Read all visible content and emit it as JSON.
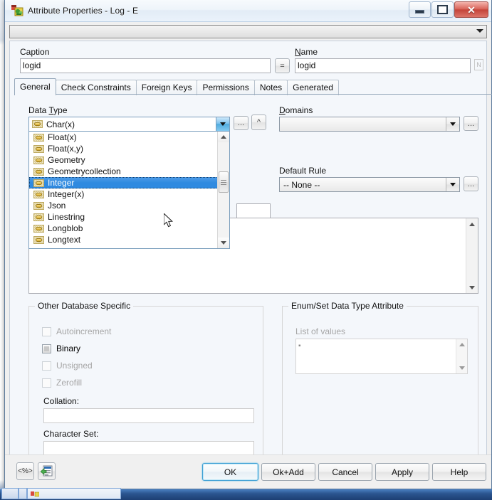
{
  "window": {
    "title": "Attribute Properties - Log - E",
    "icon": "attribute-properties-icon",
    "minimize_label": "Minimize",
    "maximize_label": "Maximize",
    "close_label": "Close"
  },
  "toolbar": {
    "overflow_label": "Toolbar options"
  },
  "fields": {
    "caption_label": "Caption",
    "caption_value": "logid",
    "equals_button": "=",
    "name_label": "Name",
    "name_label_accesskey": "N",
    "name_value": "logid",
    "name_side_button": "N"
  },
  "tabs": [
    {
      "label": "General",
      "active": true
    },
    {
      "label": "Check Constraints",
      "active": false
    },
    {
      "label": "Foreign Keys",
      "active": false
    },
    {
      "label": "Permissions",
      "active": false
    },
    {
      "label": "Notes",
      "active": false
    },
    {
      "label": "Generated",
      "active": false
    }
  ],
  "data_type": {
    "label": "Data Type",
    "label_accesskey": "T",
    "value": "Char(x)",
    "ellipsis_button": "...",
    "up_button": "^",
    "open": true,
    "items": [
      {
        "label": "Float(x)",
        "selected": false
      },
      {
        "label": "Float(x,y)",
        "selected": false
      },
      {
        "label": "Geometry",
        "selected": false
      },
      {
        "label": "Geometrycollection",
        "selected": false
      },
      {
        "label": "Integer",
        "selected": true
      },
      {
        "label": "Integer(x)",
        "selected": false
      },
      {
        "label": "Json",
        "selected": false
      },
      {
        "label": "Linestring",
        "selected": false
      },
      {
        "label": "Longblob",
        "selected": false
      },
      {
        "label": "Longtext",
        "selected": false
      }
    ]
  },
  "domains": {
    "label": "Domains",
    "label_accesskey": "D",
    "value": "",
    "ellipsis_button": "..."
  },
  "default_rule": {
    "label": "Default Rule",
    "value": "-- None --",
    "ellipsis_button": "..."
  },
  "size_field": {
    "value": ""
  },
  "comment": {
    "value": ""
  },
  "other_db_specific": {
    "title": "Other Database Specific",
    "checkboxes": [
      {
        "label": "Autoincrement",
        "checked": false,
        "enabled": false
      },
      {
        "label": "Binary",
        "checked": false,
        "enabled": true
      },
      {
        "label": "Unsigned",
        "checked": false,
        "enabled": false
      },
      {
        "label": "Zerofill",
        "checked": false,
        "enabled": false
      }
    ],
    "collation_label": "Collation:",
    "collation_value": "",
    "charset_label": "Character Set:",
    "charset_value": ""
  },
  "enum_set": {
    "title": "Enum/Set Data Type Attribute",
    "list_label": "List of values",
    "list_value": ""
  },
  "footer": {
    "sql_button": "<%>",
    "script_button": "script-icon",
    "buttons": [
      {
        "label": "OK",
        "focused": true
      },
      {
        "label": "Ok+Add",
        "focused": false
      },
      {
        "label": "Cancel",
        "focused": false
      },
      {
        "label": "Apply",
        "focused": false
      },
      {
        "label": "Help",
        "focused": false
      }
    ]
  },
  "colors": {
    "accent": "#2f8ae0",
    "title_close": "#c4443a",
    "client_bg": "#f4f7fb",
    "focus_ring": "#3c9fd4"
  }
}
